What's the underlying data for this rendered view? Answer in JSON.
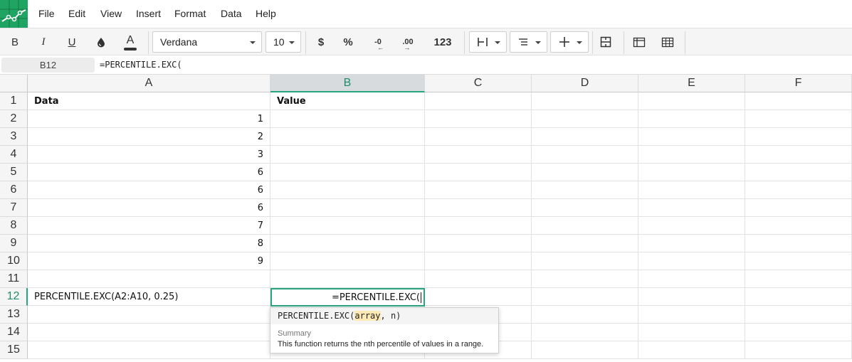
{
  "menu": [
    "File",
    "Edit",
    "View",
    "Insert",
    "Format",
    "Data",
    "Help"
  ],
  "toolbar": {
    "bold": "B",
    "italic": "I",
    "underline": "U",
    "text_color_glyph": "A",
    "font": "Verdana",
    "font_size": "10",
    "currency": "$",
    "percent": "%",
    "decrease_decimals": "-0",
    "increase_decimals": ".00",
    "number_format": "123"
  },
  "formula_bar": {
    "cell_ref": "B12",
    "formula": "=PERCENTILE.EXC("
  },
  "columns": [
    "A",
    "B",
    "C",
    "D",
    "E",
    "F"
  ],
  "rows": [
    "1",
    "2",
    "3",
    "4",
    "5",
    "6",
    "7",
    "8",
    "9",
    "10",
    "11",
    "12",
    "13",
    "14",
    "15"
  ],
  "cells": {
    "A1": "Data",
    "B1": "Value",
    "A2": "1",
    "A3": "2",
    "A4": "3",
    "A5": "6",
    "A6": "6",
    "A7": "6",
    "A8": "7",
    "A9": "8",
    "A10": "9",
    "A12": "PERCENTILE.EXC(A2:A10, 0.25)",
    "B12": "=PERCENTILE.EXC("
  },
  "autocomplete": {
    "func": "PERCENTILE.EXC(",
    "arg1": "array",
    "rest": ", n)",
    "summary_label": "Summary",
    "description": "This function returns the nth percentile of values in a range."
  },
  "colors": {
    "accent": "#27a57e",
    "logo": "#1fa463"
  }
}
